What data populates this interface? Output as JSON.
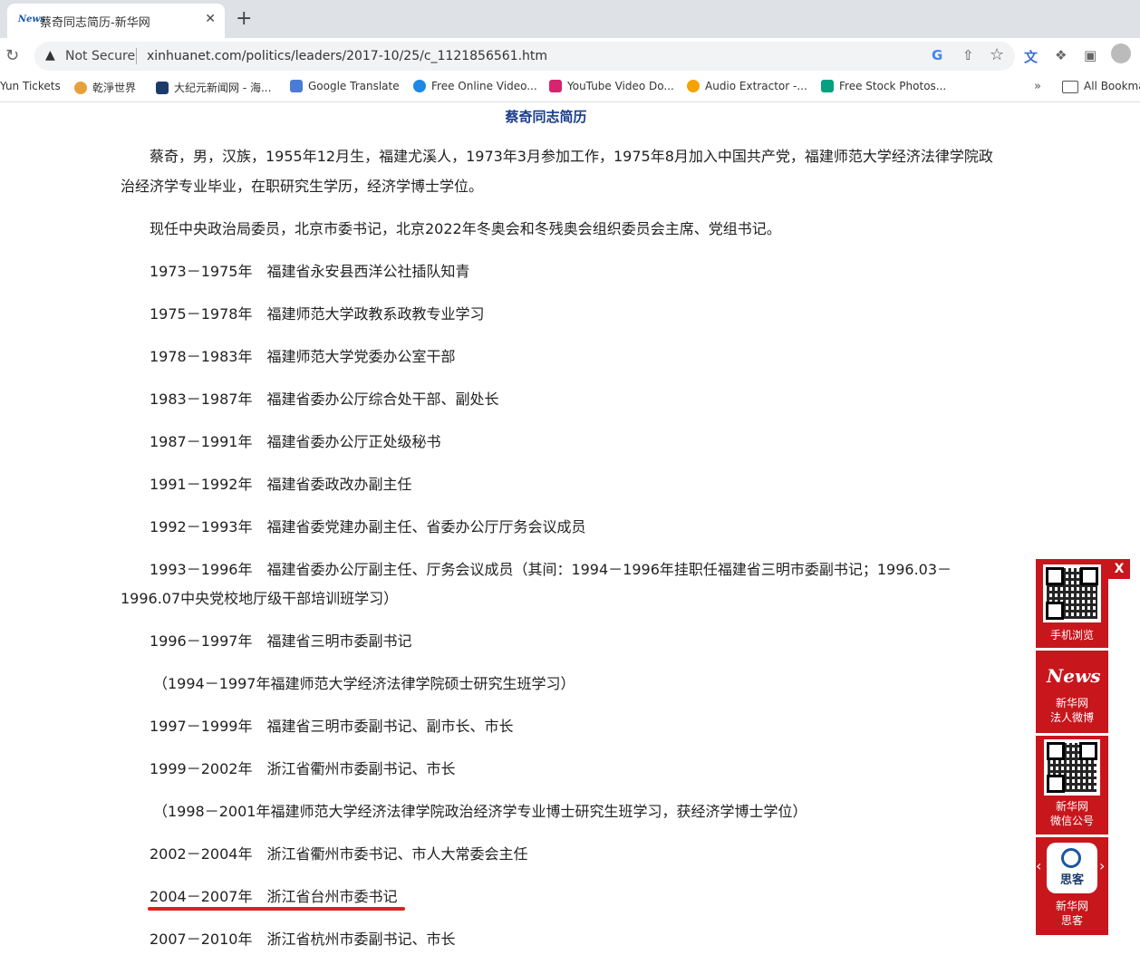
{
  "browser": {
    "tab_title": "蔡奇同志简历-新华网",
    "tab_favicon": "News",
    "close_glyph": "✕",
    "new_tab_glyph": "+",
    "security_label": "Not Secure",
    "url": "xinhuanet.com/politics/leaders/2017-10/25/c_1121856561.htm"
  },
  "bookmarks": [
    {
      "label": "Yun Tickets",
      "color": ""
    },
    {
      "label": "乾淨世界",
      "color": "#e8a03c"
    },
    {
      "label": "大纪元新闻网 - 海...",
      "color": "#1b3c6b"
    },
    {
      "label": "Google Translate",
      "color": "#4a7bd6"
    },
    {
      "label": "Free Online Video...",
      "color": "#1e88e5"
    },
    {
      "label": "YouTube Video Do...",
      "color": "#d6246e"
    },
    {
      "label": "Audio Extractor -...",
      "color": "#f4a300"
    },
    {
      "label": "Free Stock Photos...",
      "color": "#05a081"
    }
  ],
  "bookmarks_more": "»",
  "all_bookmarks": "All Bookma",
  "page": {
    "title": "蔡奇同志简历",
    "paragraphs": [
      "蔡奇，男，汉族，1955年12月生，福建尤溪人，1973年3月参加工作，1975年8月加入中国共产党，福建师范大学经济法律学院政",
      "治经济学专业毕业，在职研究生学历，经济学博士学位。",
      "现任中央政治局委员，北京市委书记，北京2022年冬奥会和冬残奥会组织委员会主席、党组书记。",
      "1973－1975年　福建省永安县西洋公社插队知青",
      "1975－1978年　福建师范大学政教系政教专业学习",
      "1978－1983年　福建师范大学党委办公室干部",
      "1983－1987年　福建省委办公厅综合处干部、副处长",
      "1987－1991年　福建省委办公厅正处级秘书",
      "1991－1992年　福建省委政改办副主任",
      "1992－1993年　福建省委党建办副主任、省委办公厅厅务会议成员",
      "1993－1996年　福建省委办公厅副主任、厅务会议成员（其间：1994－1996年挂职任福建省三明市委副书记；1996.03－",
      "1996.07中央党校地厅级干部培训班学习）",
      "1996－1997年　福建省三明市委副书记",
      "（1994－1997年福建师范大学经济法律学院硕士研究生班学习）",
      "1997－1999年　福建省三明市委副书记、副市长、市长",
      "1999－2002年　浙江省衢州市委副书记、市长",
      "（1998－2001年福建师范大学经济法律学院政治经济学专业博士研究生班学习，获经济学博士学位）",
      "2002－2004年　浙江省衢州市委书记、市人大常委会主任",
      "2004－2007年　浙江省台州市委书记",
      "2007－2010年　浙江省杭州市委副书记、市长"
    ]
  },
  "float_panel": {
    "close": "X",
    "mobile_label": "手机浏览",
    "weibo_label_1": "新华网",
    "weibo_label_2": "法人微博",
    "wechat_label_1": "新华网",
    "wechat_label_2": "微信公号",
    "sike_label_1": "新华网",
    "sike_label_2": "思客",
    "sike_logo_text": "思客",
    "news_logo_text": "News",
    "arrow_left": "‹",
    "arrow_right": "›"
  }
}
